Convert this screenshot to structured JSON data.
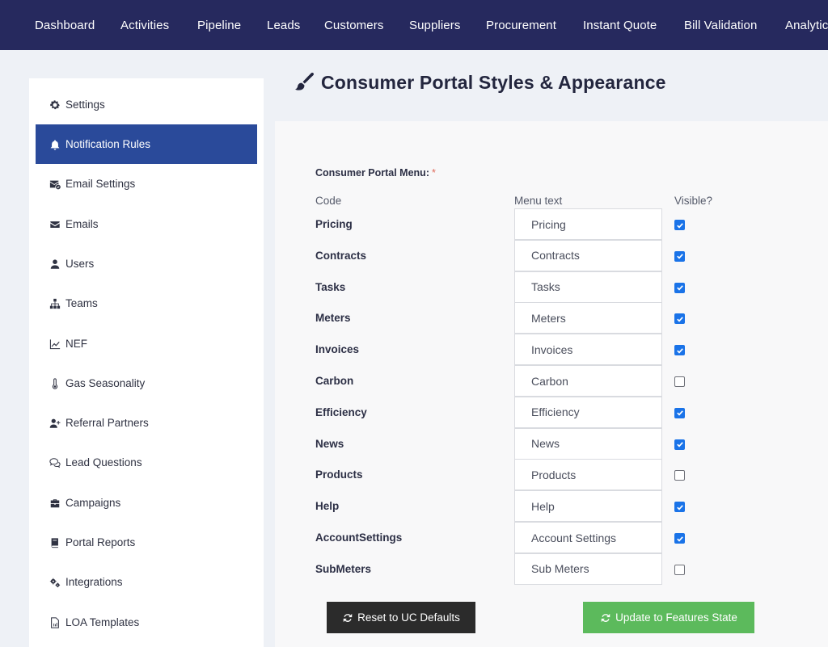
{
  "nav": {
    "items": [
      "Dashboard",
      "Activities",
      "Pipeline",
      "Leads",
      "Customers",
      "Suppliers",
      "Procurement",
      "Instant Quote",
      "Bill Validation",
      "Analytics"
    ]
  },
  "sidebar": {
    "items": [
      {
        "label": "Settings",
        "icon": "gear-icon"
      },
      {
        "label": "Notification Rules",
        "icon": "bell-icon",
        "active": true
      },
      {
        "label": "Email Settings",
        "icon": "envelope-check-icon"
      },
      {
        "label": "Emails",
        "icon": "envelope-icon"
      },
      {
        "label": "Users",
        "icon": "user-icon"
      },
      {
        "label": "Teams",
        "icon": "sitemap-icon"
      },
      {
        "label": "NEF",
        "icon": "line-chart-icon"
      },
      {
        "label": "Gas Seasonality",
        "icon": "thermometer-icon"
      },
      {
        "label": "Referral Partners",
        "icon": "user-plus-icon"
      },
      {
        "label": "Lead Questions",
        "icon": "comments-icon"
      },
      {
        "label": "Campaigns",
        "icon": "briefcase-icon"
      },
      {
        "label": "Portal Reports",
        "icon": "book-icon"
      },
      {
        "label": "Integrations",
        "icon": "cogs-icon"
      },
      {
        "label": "LOA Templates",
        "icon": "file-icon"
      }
    ]
  },
  "page": {
    "title": "Consumer Portal Styles & Appearance",
    "title_icon": "paint-brush-icon"
  },
  "menu": {
    "label": "Consumer Portal Menu:",
    "required_mark": "*",
    "headers": {
      "code": "Code",
      "text": "Menu text",
      "visible": "Visible?"
    },
    "rows": [
      {
        "code": "Pricing",
        "text": "Pricing",
        "visible": true
      },
      {
        "code": "Contracts",
        "text": "Contracts",
        "visible": true
      },
      {
        "code": "Tasks",
        "text": "Tasks",
        "visible": true
      },
      {
        "code": "Meters",
        "text": "Meters",
        "visible": true
      },
      {
        "code": "Invoices",
        "text": "Invoices",
        "visible": true
      },
      {
        "code": "Carbon",
        "text": "Carbon",
        "visible": false
      },
      {
        "code": "Efficiency",
        "text": "Efficiency",
        "visible": true
      },
      {
        "code": "News",
        "text": "News",
        "visible": true
      },
      {
        "code": "Products",
        "text": "Products",
        "visible": false
      },
      {
        "code": "Help",
        "text": "Help",
        "visible": true
      },
      {
        "code": "AccountSettings",
        "text": "Account Settings",
        "visible": true
      },
      {
        "code": "SubMeters",
        "text": "Sub Meters",
        "visible": false
      }
    ]
  },
  "buttons": {
    "reset": "Reset to UC Defaults",
    "update": "Update to Features State"
  },
  "colors": {
    "nav_bg": "#26295e",
    "active_item": "#2a4a9a",
    "update_button": "#5cba5c",
    "reset_button": "#2b2b2b",
    "checkbox_on": "#1a73e8"
  }
}
